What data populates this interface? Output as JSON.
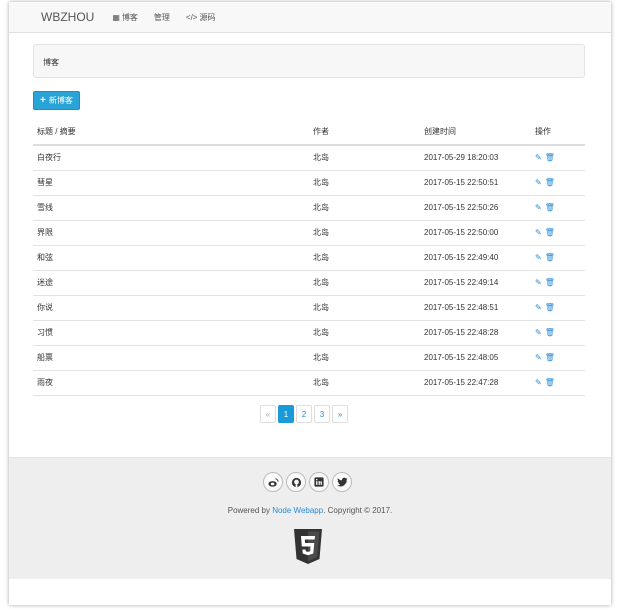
{
  "navbar": {
    "brand": "WBZHOU",
    "items": [
      {
        "label": "博客",
        "icon": "book-icon"
      },
      {
        "label": "管理",
        "icon": ""
      },
      {
        "label": "源码",
        "icon": "code-icon"
      }
    ]
  },
  "panel": {
    "title": "博客"
  },
  "new_button": {
    "label": "新博客"
  },
  "table": {
    "headers": [
      "标题 / 摘要",
      "作者",
      "创建时间",
      "操作"
    ],
    "rows": [
      {
        "title": "白夜行",
        "author": "北岛",
        "time": "2017-05-29 18:20:03"
      },
      {
        "title": "彗星",
        "author": "北岛",
        "time": "2017-05-15 22:50:51"
      },
      {
        "title": "雪线",
        "author": "北岛",
        "time": "2017-05-15 22:50:26"
      },
      {
        "title": "界限",
        "author": "北岛",
        "time": "2017-05-15 22:50:00"
      },
      {
        "title": "和弦",
        "author": "北岛",
        "time": "2017-05-15 22:49:40"
      },
      {
        "title": "迷途",
        "author": "北岛",
        "time": "2017-05-15 22:49:14"
      },
      {
        "title": "你说",
        "author": "北岛",
        "time": "2017-05-15 22:48:51"
      },
      {
        "title": "习惯",
        "author": "北岛",
        "time": "2017-05-15 22:48:28"
      },
      {
        "title": "船票",
        "author": "北岛",
        "time": "2017-05-15 22:48:05"
      },
      {
        "title": "雨夜",
        "author": "北岛",
        "time": "2017-05-15 22:47:28"
      }
    ]
  },
  "pagination": {
    "prev": "«",
    "pages": [
      "1",
      "2",
      "3"
    ],
    "active": "1",
    "next": "»"
  },
  "footer": {
    "social": [
      "weibo-icon",
      "github-icon",
      "linkedin-icon",
      "twitter-icon"
    ],
    "powered_prefix": "Powered by ",
    "powered_link": "Node Webapp",
    "powered_suffix": ". Copyright © 2017."
  },
  "colors": {
    "accent": "#2aa3d6",
    "link": "#2a8ad4",
    "footer_bg": "#eeeeee"
  }
}
